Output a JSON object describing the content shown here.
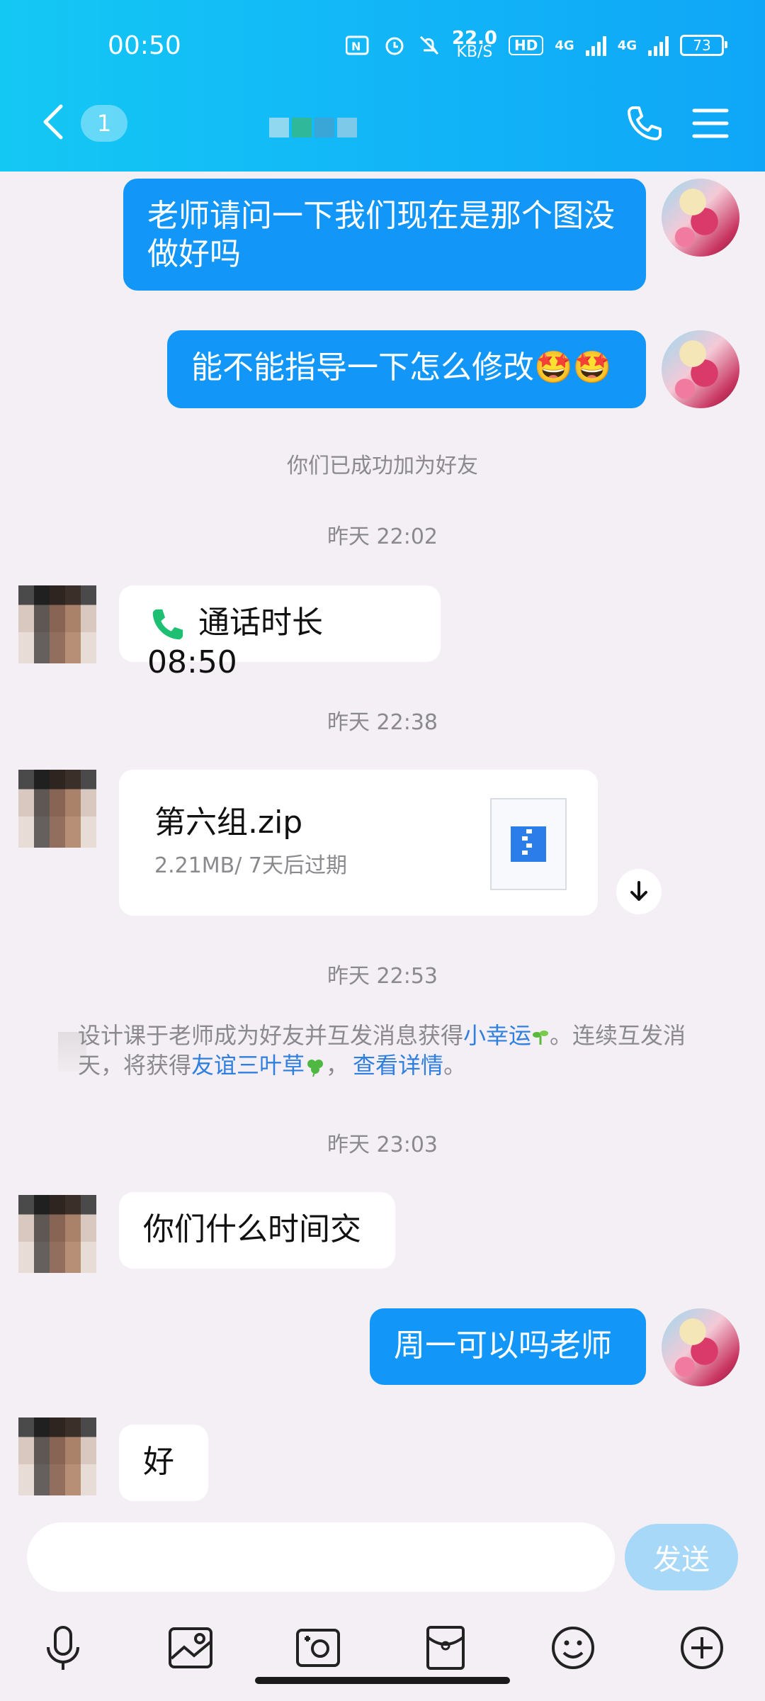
{
  "status_bar": {
    "time": "00:50",
    "net_speed": "22.0",
    "net_unit": "KB/S",
    "hd_label": "HD",
    "net_type_1": "4G",
    "net_type_2": "4G",
    "battery": "73"
  },
  "header": {
    "unread_count": "1"
  },
  "messages": {
    "m1": "老师请问一下我们现在是那个图没做好吗",
    "m2": "能不能指导一下怎么修改🤩🤩",
    "sys_added": "你们已成功加为好友",
    "t1": "昨天 22:02",
    "call_text": "通话时长 08:50",
    "t2": "昨天 22:38",
    "file_name": "第六组.zip",
    "file_meta": "2.21MB/ 7天后过期",
    "t3": "昨天 22:53",
    "notice_a": "设计课于老师成为好友并互发消息获得",
    "notice_link1": "小幸运",
    "notice_b": "。连续互发消",
    "notice_c": "天，将获得",
    "notice_link2": "友谊三叶草",
    "notice_d": "，",
    "notice_link3": "查看详情",
    "notice_e": "。",
    "t4": "昨天 23:03",
    "m3": "你们什么时间交",
    "m4": "周一可以吗老师",
    "m5": "好"
  },
  "composer": {
    "placeholder": "",
    "send_label": "发送"
  },
  "icons": {
    "back": "chevron-left-icon",
    "phone": "phone-icon",
    "menu": "menu-icon",
    "call": "phone-call-icon",
    "download": "download-icon",
    "mic": "microphone-icon",
    "image": "image-icon",
    "camera": "camera-icon",
    "red_packet": "red-packet-icon",
    "emoji": "emoji-icon",
    "plus": "plus-circle-icon"
  },
  "colors": {
    "header_start": "#14c8f4",
    "header_end": "#0fa6f7",
    "my_bubble": "#1296f7",
    "link": "#2f7fe0",
    "send_button": "#a8d8f7"
  }
}
